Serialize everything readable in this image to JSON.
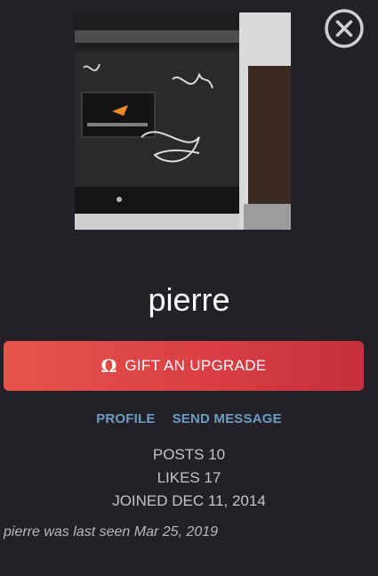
{
  "profile": {
    "avatar_icon": "avatar-photo",
    "username": "pierre",
    "close_icon": "close-circle-icon"
  },
  "gift": {
    "icon_glyph": "Ω",
    "icon_name": "omega-icon",
    "label": "GIFT AN UPGRADE"
  },
  "links": {
    "profile": "PROFILE",
    "send_message": "SEND MESSAGE"
  },
  "stats": {
    "posts": "POSTS 10",
    "likes": "LIKES 17",
    "joined": "JOINED DEC 11, 2014"
  },
  "last_seen": "pierre was last seen Mar 25, 2019",
  "colors": {
    "background": "#232127",
    "button_red": "#d93f44",
    "link_blue": "#6b9dc2",
    "stat_text": "#c4c4c8"
  }
}
